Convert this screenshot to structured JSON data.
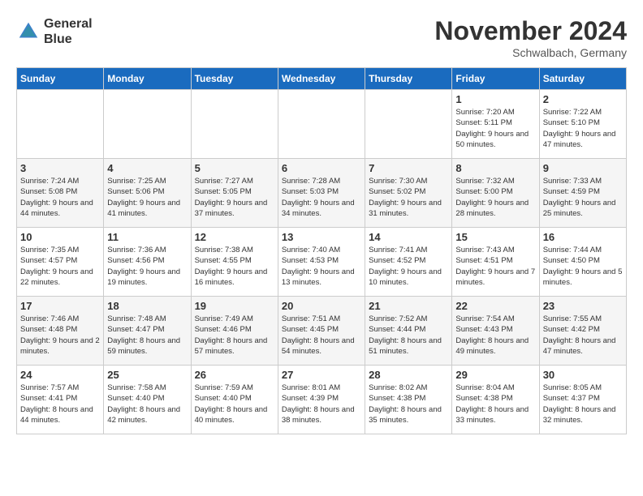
{
  "header": {
    "logo_line1": "General",
    "logo_line2": "Blue",
    "month": "November 2024",
    "location": "Schwalbach, Germany"
  },
  "weekdays": [
    "Sunday",
    "Monday",
    "Tuesday",
    "Wednesday",
    "Thursday",
    "Friday",
    "Saturday"
  ],
  "weeks": [
    [
      {
        "day": "",
        "info": ""
      },
      {
        "day": "",
        "info": ""
      },
      {
        "day": "",
        "info": ""
      },
      {
        "day": "",
        "info": ""
      },
      {
        "day": "",
        "info": ""
      },
      {
        "day": "1",
        "info": "Sunrise: 7:20 AM\nSunset: 5:11 PM\nDaylight: 9 hours\nand 50 minutes."
      },
      {
        "day": "2",
        "info": "Sunrise: 7:22 AM\nSunset: 5:10 PM\nDaylight: 9 hours\nand 47 minutes."
      }
    ],
    [
      {
        "day": "3",
        "info": "Sunrise: 7:24 AM\nSunset: 5:08 PM\nDaylight: 9 hours\nand 44 minutes."
      },
      {
        "day": "4",
        "info": "Sunrise: 7:25 AM\nSunset: 5:06 PM\nDaylight: 9 hours\nand 41 minutes."
      },
      {
        "day": "5",
        "info": "Sunrise: 7:27 AM\nSunset: 5:05 PM\nDaylight: 9 hours\nand 37 minutes."
      },
      {
        "day": "6",
        "info": "Sunrise: 7:28 AM\nSunset: 5:03 PM\nDaylight: 9 hours\nand 34 minutes."
      },
      {
        "day": "7",
        "info": "Sunrise: 7:30 AM\nSunset: 5:02 PM\nDaylight: 9 hours\nand 31 minutes."
      },
      {
        "day": "8",
        "info": "Sunrise: 7:32 AM\nSunset: 5:00 PM\nDaylight: 9 hours\nand 28 minutes."
      },
      {
        "day": "9",
        "info": "Sunrise: 7:33 AM\nSunset: 4:59 PM\nDaylight: 9 hours\nand 25 minutes."
      }
    ],
    [
      {
        "day": "10",
        "info": "Sunrise: 7:35 AM\nSunset: 4:57 PM\nDaylight: 9 hours\nand 22 minutes."
      },
      {
        "day": "11",
        "info": "Sunrise: 7:36 AM\nSunset: 4:56 PM\nDaylight: 9 hours\nand 19 minutes."
      },
      {
        "day": "12",
        "info": "Sunrise: 7:38 AM\nSunset: 4:55 PM\nDaylight: 9 hours\nand 16 minutes."
      },
      {
        "day": "13",
        "info": "Sunrise: 7:40 AM\nSunset: 4:53 PM\nDaylight: 9 hours\nand 13 minutes."
      },
      {
        "day": "14",
        "info": "Sunrise: 7:41 AM\nSunset: 4:52 PM\nDaylight: 9 hours\nand 10 minutes."
      },
      {
        "day": "15",
        "info": "Sunrise: 7:43 AM\nSunset: 4:51 PM\nDaylight: 9 hours\nand 7 minutes."
      },
      {
        "day": "16",
        "info": "Sunrise: 7:44 AM\nSunset: 4:50 PM\nDaylight: 9 hours\nand 5 minutes."
      }
    ],
    [
      {
        "day": "17",
        "info": "Sunrise: 7:46 AM\nSunset: 4:48 PM\nDaylight: 9 hours\nand 2 minutes."
      },
      {
        "day": "18",
        "info": "Sunrise: 7:48 AM\nSunset: 4:47 PM\nDaylight: 8 hours\nand 59 minutes."
      },
      {
        "day": "19",
        "info": "Sunrise: 7:49 AM\nSunset: 4:46 PM\nDaylight: 8 hours\nand 57 minutes."
      },
      {
        "day": "20",
        "info": "Sunrise: 7:51 AM\nSunset: 4:45 PM\nDaylight: 8 hours\nand 54 minutes."
      },
      {
        "day": "21",
        "info": "Sunrise: 7:52 AM\nSunset: 4:44 PM\nDaylight: 8 hours\nand 51 minutes."
      },
      {
        "day": "22",
        "info": "Sunrise: 7:54 AM\nSunset: 4:43 PM\nDaylight: 8 hours\nand 49 minutes."
      },
      {
        "day": "23",
        "info": "Sunrise: 7:55 AM\nSunset: 4:42 PM\nDaylight: 8 hours\nand 47 minutes."
      }
    ],
    [
      {
        "day": "24",
        "info": "Sunrise: 7:57 AM\nSunset: 4:41 PM\nDaylight: 8 hours\nand 44 minutes."
      },
      {
        "day": "25",
        "info": "Sunrise: 7:58 AM\nSunset: 4:40 PM\nDaylight: 8 hours\nand 42 minutes."
      },
      {
        "day": "26",
        "info": "Sunrise: 7:59 AM\nSunset: 4:40 PM\nDaylight: 8 hours\nand 40 minutes."
      },
      {
        "day": "27",
        "info": "Sunrise: 8:01 AM\nSunset: 4:39 PM\nDaylight: 8 hours\nand 38 minutes."
      },
      {
        "day": "28",
        "info": "Sunrise: 8:02 AM\nSunset: 4:38 PM\nDaylight: 8 hours\nand 35 minutes."
      },
      {
        "day": "29",
        "info": "Sunrise: 8:04 AM\nSunset: 4:38 PM\nDaylight: 8 hours\nand 33 minutes."
      },
      {
        "day": "30",
        "info": "Sunrise: 8:05 AM\nSunset: 4:37 PM\nDaylight: 8 hours\nand 32 minutes."
      }
    ]
  ]
}
